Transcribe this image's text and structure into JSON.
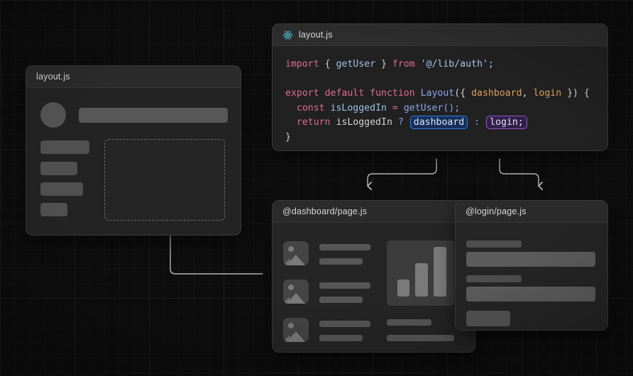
{
  "canvas": {
    "background_color": "#0d0d0d",
    "grid_color": "#262626"
  },
  "panels": {
    "layout_wireframe": {
      "title": "layout.js",
      "slot_label": "",
      "nav_items_count": 4
    },
    "code": {
      "title": "layout.js",
      "icon": "react-icon",
      "language": "javascript",
      "lines": [
        {
          "id": "l1",
          "text": "import { getUser } from '@/lib/auth';"
        },
        {
          "id": "l2",
          "text": ""
        },
        {
          "id": "l3",
          "text": "export default function Layout({ dashboard, login }) {"
        },
        {
          "id": "l4",
          "text": "  const isLoggedIn = getUser();"
        },
        {
          "id": "l5",
          "text": "  return isLoggedIn ? dashboard : login;"
        },
        {
          "id": "l6",
          "text": "}"
        }
      ],
      "tokens": {
        "import": "import",
        "brace_open": " { ",
        "getUser": "getUser",
        "brace_close": " } ",
        "from": "from",
        "module_path": " '@/lib/auth';",
        "export": "export",
        "default": "default",
        "function": "function",
        "layout_name": "Layout",
        "params_open": "({ ",
        "param_dashboard": "dashboard",
        "param_comma": ", ",
        "param_login": "login",
        "params_close": " }) {",
        "const": "const",
        "isLoggedIn": "isLoggedIn",
        "equals": "=",
        "getUser_call": "getUser();",
        "return": "return",
        "isLoggedIn_ref": "isLoggedIn",
        "question": "?",
        "colon": ":",
        "closing_brace": "}"
      },
      "highlights": {
        "dashboard": {
          "text": "dashboard",
          "border_color": "#2f7fe0",
          "fill_color": "#15305c"
        },
        "login": {
          "text": "login;",
          "border_color": "#9a52c9",
          "fill_color": "#31214a"
        }
      }
    },
    "dashboard_page": {
      "title": "@dashboard/page.js",
      "rows": 3,
      "chart": {
        "type": "bar",
        "bars": [
          24,
          47,
          70
        ]
      }
    },
    "login_page": {
      "title": "@login/page.js",
      "fields": 2,
      "has_submit": true
    }
  },
  "connectors": {
    "slot_arrow": {
      "from": "dashboard-panel",
      "to": "layout-slot",
      "color": "#b8b8b8"
    },
    "dashboard_arrow": {
      "from": "code-dashboard-token",
      "to": "dashboard-panel",
      "color": "#b8b8b8"
    },
    "login_arrow": {
      "from": "code-login-token",
      "to": "login-panel",
      "color": "#b8b8b8"
    }
  }
}
